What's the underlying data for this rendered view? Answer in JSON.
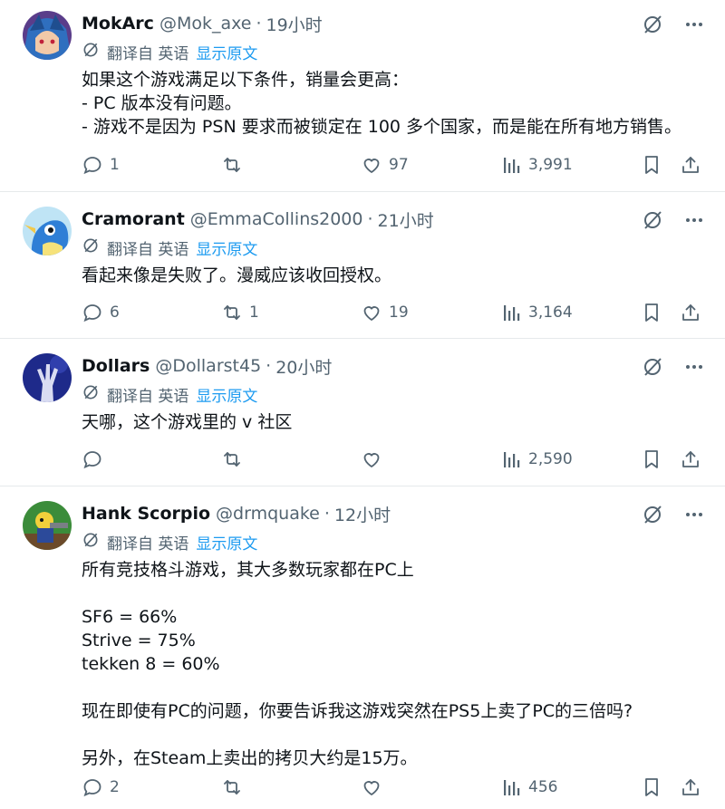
{
  "translate": {
    "label": "翻译自 英语",
    "link": "显示原文"
  },
  "tweets": [
    {
      "name": "MokArc",
      "handle": "@Mok_axe",
      "time": "19小时",
      "lines": [
        "如果这个游戏满足以下条件，销量会更高：",
        "- PC 版本没有问题。",
        "- 游戏不是因为 PSN 要求而被锁定在 100 多个国家，而是能在所有地方销售。"
      ],
      "replies": "1",
      "retweets": "",
      "likes": "97",
      "views": "3,991"
    },
    {
      "name": "Cramorant",
      "handle": "@EmmaCollins2000",
      "time": "21小时",
      "lines": [
        "看起来像是失败了。漫威应该收回授权。"
      ],
      "replies": "6",
      "retweets": "1",
      "likes": "19",
      "views": "3,164"
    },
    {
      "name": "Dollars",
      "handle": "@Dollarst45",
      "time": "20小时",
      "lines": [
        "天哪，这个游戏里的 v 社区"
      ],
      "replies": "",
      "retweets": "",
      "likes": "",
      "views": "2,590"
    },
    {
      "name": "Hank Scorpio",
      "handle": "@drmquake",
      "time": "12小时",
      "lines": [
        "所有竞技格斗游戏，其大多数玩家都在PC上",
        "",
        "SF6 = 66%",
        "Strive = 75%",
        "tekken 8 = 60%",
        "",
        "现在即使有PC的问题，你要告诉我这游戏突然在PS5上卖了PC的三倍吗?",
        "",
        "另外，在Steam上卖出的拷贝大约是15万。"
      ],
      "replies": "2",
      "retweets": "",
      "likes": "",
      "views": "456"
    }
  ]
}
